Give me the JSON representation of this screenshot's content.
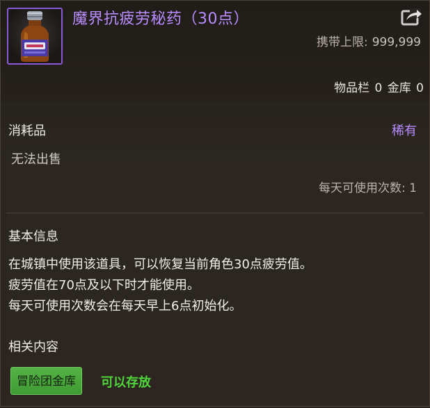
{
  "item": {
    "name": "魔界抗疲劳秘药（30点）",
    "icon": "potion-bottle-icon",
    "rarity_color": "#b98cff"
  },
  "header": {
    "carry_limit_label": "携带上限:",
    "carry_limit_value": "999,999",
    "inventory_label": "物品栏",
    "inventory_count": "0",
    "vault_label": "金库",
    "vault_count": "0"
  },
  "properties": {
    "category": "消耗品",
    "rarity": "稀有",
    "sell_status": "无法出售",
    "daily_uses_label": "每天可使用次数:",
    "daily_uses_value": "1"
  },
  "basic_info": {
    "title": "基本信息",
    "lines": [
      "在城镇中使用该道具，可以恢复当前角色30点疲劳值。",
      "疲劳值在70点及以下时才能使用。",
      "每天可使用次数会在每天早上6点初始化。"
    ]
  },
  "related": {
    "title": "相关内容",
    "tag_label": "冒险团金库",
    "tag_status": "可以存放",
    "tag_color": "#4fae3f",
    "status_color": "#4fd63c"
  }
}
